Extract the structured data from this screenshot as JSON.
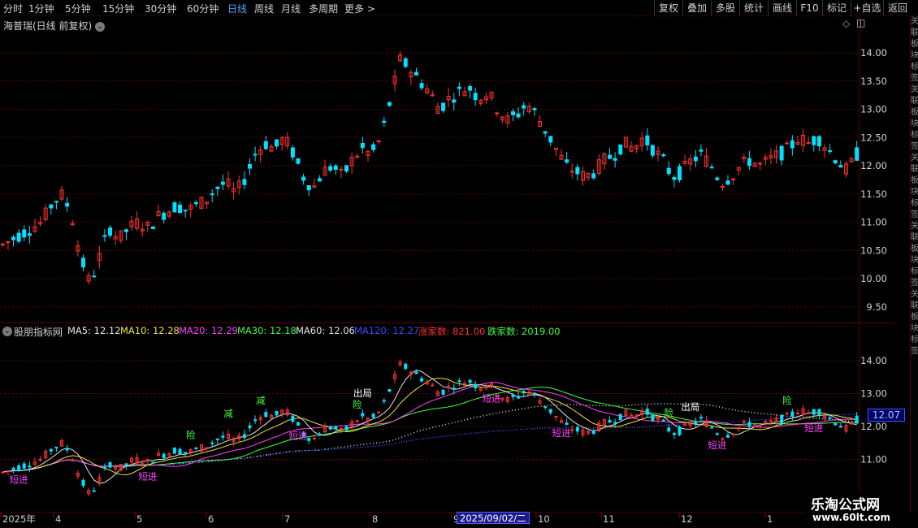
{
  "toolbar": {
    "timeframes": [
      "分时",
      "1分钟",
      "5分钟",
      "15分钟",
      "30分钟",
      "60分钟",
      "日线",
      "周线",
      "月线",
      "多周期",
      "更多"
    ],
    "active_index": 6,
    "more_arrow": ">",
    "right_buttons": [
      "复权",
      "叠加",
      "多股",
      "统计",
      "画线",
      "F10",
      "标记",
      "+自选",
      "返回"
    ]
  },
  "main_panel": {
    "title": "海普瑞(日线 前复权)",
    "price_ticks": [
      "14.00",
      "13.50",
      "13.00",
      "12.50",
      "12.00",
      "11.50",
      "11.00",
      "10.50",
      "10.00",
      "9.50"
    ]
  },
  "indicator_panel": {
    "title": "股朋指标网",
    "ma_items": [
      {
        "label": "MA5: 12.12",
        "color": "#e6e6e6"
      },
      {
        "label": "MA10: 12.28",
        "color": "#f0e040"
      },
      {
        "label": "MA20: 12.29",
        "color": "#ff40ff"
      },
      {
        "label": "MA30: 12.18",
        "color": "#40ff40"
      },
      {
        "label": "MA60: 12.06",
        "color": "#e6e6e6"
      },
      {
        "label": "MA120: 12.27",
        "color": "#3a4aff"
      },
      {
        "label": "涨家数: 821.00",
        "color": "#ff3030"
      },
      {
        "label": "跌家数: 2019.00",
        "color": "#40ff40"
      }
    ],
    "price_ticks": [
      "14.00",
      "13.00",
      "12.00",
      "11.00"
    ],
    "last_price": "12.07",
    "annotations": {
      "exit": "出局",
      "short_enter": "短进",
      "risk": "险",
      "reduce": "减",
      "trend_wave": "趋势"
    }
  },
  "x_axis": {
    "labels": [
      "2025年",
      "4",
      "5",
      "6",
      "7",
      "8",
      "9",
      "10",
      "11",
      "12",
      "1"
    ],
    "cursor_date": "2025/09/02/二"
  },
  "right_strip_text": "关联板块标签",
  "watermark": {
    "line1": "乐淘公式网",
    "line2": "www.60lt.com"
  },
  "colors": {
    "up": "#ff3030",
    "down": "#00e0ff",
    "grid": "#6a0000",
    "bg": "#000000"
  },
  "chart_data": {
    "type": "candlestick",
    "ylim": [
      9.3,
      14.4
    ],
    "approx_close_series": [
      10.6,
      10.7,
      10.8,
      10.9,
      11.0,
      11.3,
      11.5,
      11.2,
      10.4,
      9.9,
      10.4,
      10.9,
      10.7,
      10.9,
      11.0,
      10.9,
      11.1,
      11.2,
      11.3,
      11.2,
      11.3,
      11.4,
      11.6,
      11.7,
      11.5,
      11.8,
      12.2,
      12.4,
      12.3,
      12.5,
      12.2,
      11.8,
      11.6,
      11.9,
      12.0,
      11.8,
      12.1,
      12.3,
      12.2,
      12.5,
      13.2,
      13.9,
      13.7,
      13.5,
      13.3,
      13.0,
      13.2,
      13.3,
      13.4,
      13.2,
      13.3,
      13.0,
      12.8,
      12.9,
      13.1,
      12.9,
      12.6,
      12.3,
      12.0,
      11.9,
      11.8,
      11.9,
      12.1,
      12.2,
      12.4,
      12.3,
      12.5,
      12.3,
      12.1,
      11.8,
      11.9,
      12.1,
      12.2,
      12.0,
      11.7,
      11.8,
      12.0,
      12.1,
      12.0,
      12.1,
      12.2,
      12.3,
      12.5,
      12.4,
      12.5,
      12.3,
      12.1,
      11.9,
      12.2
    ]
  }
}
